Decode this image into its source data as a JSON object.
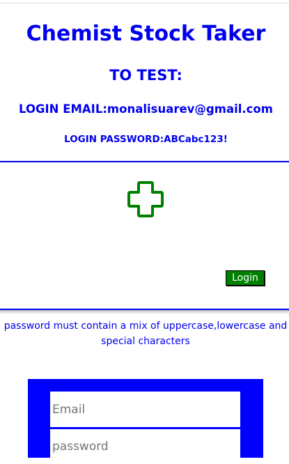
{
  "app": {
    "title": "Chemist Stock Taker"
  },
  "test_info": {
    "heading": "TO TEST:",
    "email_line": "LOGIN EMAIL:monalisuarev@gmail.com",
    "password_line": "LOGIN PASSWORD:ABCabc123!"
  },
  "login_box": {
    "logo_icon": "medical-cross-icon",
    "logo_color": "#008000",
    "login_label": "Login"
  },
  "hint": {
    "text": "password must contain a mix of uppercase,lowercase and special characters"
  },
  "form": {
    "email_placeholder": "Email",
    "password_placeholder": "password"
  },
  "colors": {
    "accent": "#0000ee",
    "panel": "#0000ff",
    "button": "#008000"
  }
}
